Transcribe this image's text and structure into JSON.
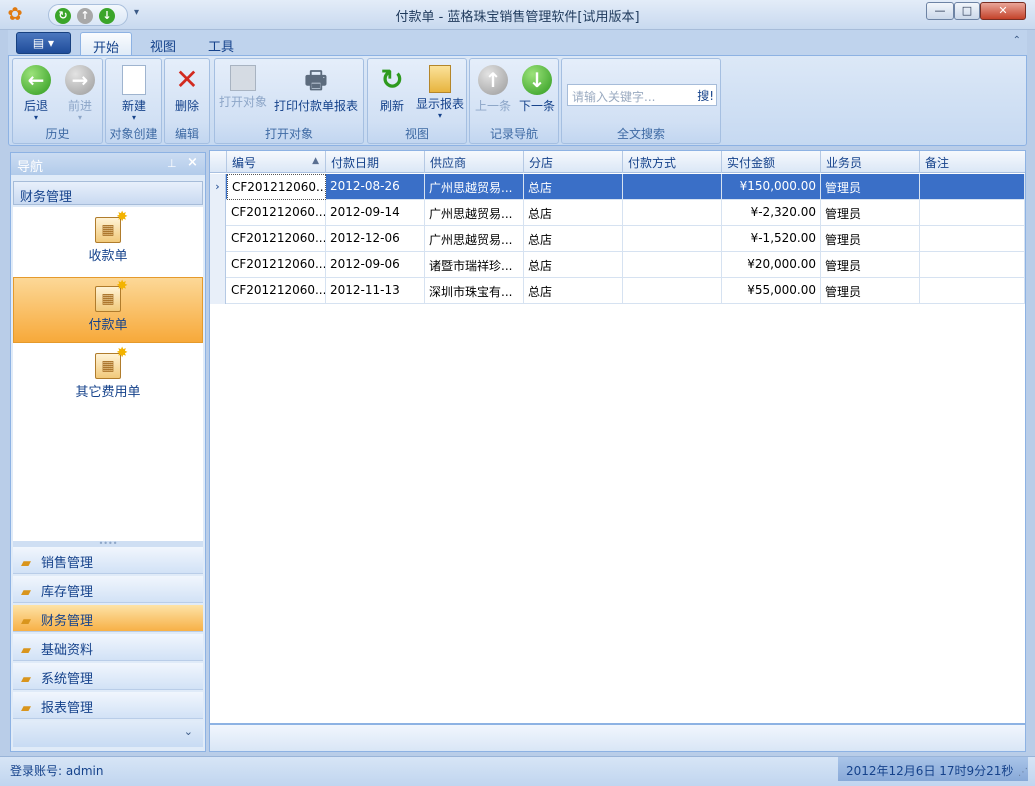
{
  "window": {
    "title": "付款单 - 蓝格珠宝销售管理软件[试用版本]",
    "controls": {
      "minimize": "—",
      "maximize": "□",
      "close": "✕"
    }
  },
  "quick_access": {
    "more": "▾"
  },
  "tabs": [
    "开始",
    "视图",
    "工具"
  ],
  "ribbon": {
    "groups": [
      {
        "title": "历史",
        "buttons": [
          {
            "label": "后退",
            "icon": "back-arrow"
          },
          {
            "label": "前进",
            "icon": "forward-arrow"
          }
        ]
      },
      {
        "title": "对象创建",
        "buttons": [
          {
            "label": "新建",
            "icon": "new-document"
          }
        ]
      },
      {
        "title": "编辑",
        "buttons": [
          {
            "label": "删除",
            "icon": "delete-x"
          }
        ]
      },
      {
        "title": "打开对象",
        "buttons": [
          {
            "label": "打开对象",
            "icon": "open-object"
          },
          {
            "label": "打印付款单报表",
            "icon": "printer"
          }
        ]
      },
      {
        "title": "视图",
        "buttons": [
          {
            "label": "刷新",
            "icon": "refresh"
          },
          {
            "label": "显示报表",
            "icon": "clipboard-report"
          }
        ]
      },
      {
        "title": "记录导航",
        "buttons": [
          {
            "label": "上一条",
            "icon": "up-arrow"
          },
          {
            "label": "下一条",
            "icon": "down-arrow"
          }
        ]
      },
      {
        "title": "全文搜索",
        "search_placeholder": "请输入关键字...",
        "search_button": "搜!"
      }
    ]
  },
  "nav": {
    "header": "导航",
    "group": "财务管理",
    "items": [
      "收款单",
      "付款单",
      "其它费用单"
    ],
    "selected_item": "付款单",
    "modules": [
      "销售管理",
      "库存管理",
      "财务管理",
      "基础资料",
      "系统管理",
      "报表管理"
    ],
    "selected_module": "财务管理",
    "collapse": "⌄"
  },
  "grid": {
    "columns": [
      "编号",
      "付款日期",
      "供应商",
      "分店",
      "付款方式",
      "实付金额",
      "业务员",
      "备注"
    ],
    "sort_indicator": "▲",
    "rows": [
      [
        "CF201212060...",
        "2012-08-26",
        "广州思越贸易...",
        "总店",
        "",
        "¥150,000.00",
        "管理员",
        ""
      ],
      [
        "CF201212060...",
        "2012-09-14",
        "广州思越贸易...",
        "总店",
        "",
        "¥-2,320.00",
        "管理员",
        ""
      ],
      [
        "CF201212060...",
        "2012-12-06",
        "广州思越贸易...",
        "总店",
        "",
        "¥-1,520.00",
        "管理员",
        ""
      ],
      [
        "CF201212060...",
        "2012-09-06",
        "诸暨市瑞祥珍...",
        "总店",
        "",
        "¥20,000.00",
        "管理员",
        ""
      ],
      [
        "CF201212060...",
        "2012-11-13",
        "深圳市珠宝有...",
        "总店",
        "",
        "¥55,000.00",
        "管理员",
        ""
      ]
    ],
    "current_row_marker": "›"
  },
  "status": {
    "login": "登录账号: admin",
    "clock": "2012年12月6日 17时9分21秒"
  }
}
